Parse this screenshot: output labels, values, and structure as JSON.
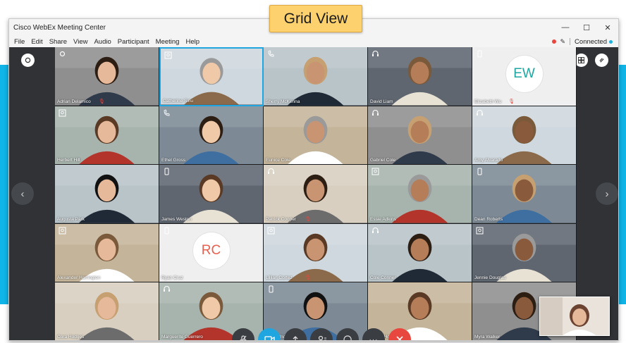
{
  "callout": {
    "label": "Grid View"
  },
  "window": {
    "title": "Cisco WebEx Meeting Center",
    "controls": {
      "minimize": "—",
      "maximize": "☐",
      "close": "✕"
    }
  },
  "menu": {
    "items": [
      "File",
      "Edit",
      "Share",
      "View",
      "Audio",
      "Participant",
      "Meeting",
      "Help"
    ],
    "status": "Connected"
  },
  "colors": {
    "accent": "#1fa6e0",
    "end_call": "#e8473f",
    "stage_bg": "#303236",
    "callout_bg": "#fdd16e"
  },
  "participants": [
    {
      "name": "Adrian Delamico",
      "device": "video",
      "muted": true
    },
    {
      "name": "Catherine Sinu",
      "device": "camera-device",
      "muted": false,
      "active": true
    },
    {
      "name": "Sherry McKenna",
      "device": "phone",
      "muted": false
    },
    {
      "name": "David Liam",
      "device": "headset",
      "muted": false
    },
    {
      "name": "Elizabeth Wu",
      "device": "mobile",
      "muted": true,
      "initials": "EW"
    },
    {
      "name": "Herbert Hill",
      "device": "camera-device",
      "muted": false
    },
    {
      "name": "Ethel Gross",
      "device": "phone",
      "muted": false
    },
    {
      "name": "Eunice Cole",
      "device": "",
      "muted": false
    },
    {
      "name": "Gabriel Cole",
      "device": "headset",
      "muted": false
    },
    {
      "name": "Amy Alvarado",
      "device": "headset",
      "muted": false
    },
    {
      "name": "Augusta Park",
      "device": "",
      "muted": false
    },
    {
      "name": "James Weston",
      "device": "mobile",
      "muted": false
    },
    {
      "name": "Patrick Cooper",
      "device": "headset",
      "muted": true
    },
    {
      "name": "Essie Adkins",
      "device": "camera-device",
      "muted": false
    },
    {
      "name": "Dean Roberts",
      "device": "mobile",
      "muted": false
    },
    {
      "name": "Alexander Harrington",
      "device": "camera-device",
      "muted": false
    },
    {
      "name": "Ryan Cruz",
      "device": "mobile",
      "muted": false,
      "initials": "RC"
    },
    {
      "name": "Lillian Cortez",
      "device": "camera-device",
      "muted": true
    },
    {
      "name": "Cole Conner",
      "device": "headset",
      "muted": false
    },
    {
      "name": "Jennie Douglas",
      "device": "camera-device",
      "muted": false
    },
    {
      "name": "Cora Hodges",
      "device": "",
      "muted": false
    },
    {
      "name": "Marguerite Guerrero",
      "device": "headset",
      "muted": false
    },
    {
      "name": "Mark Underwood",
      "device": "mobile",
      "muted": false
    },
    {
      "name": "Arthur Howell",
      "device": "",
      "muted": false
    },
    {
      "name": "Myra Walker",
      "device": "",
      "muted": false
    }
  ],
  "controls": {
    "buttons": [
      "mute-microphone",
      "stop-video",
      "share-content",
      "participants",
      "chat",
      "more-options",
      "end-meeting"
    ],
    "more_label": "···"
  },
  "navigation": {
    "prev": "‹",
    "next": "›"
  }
}
